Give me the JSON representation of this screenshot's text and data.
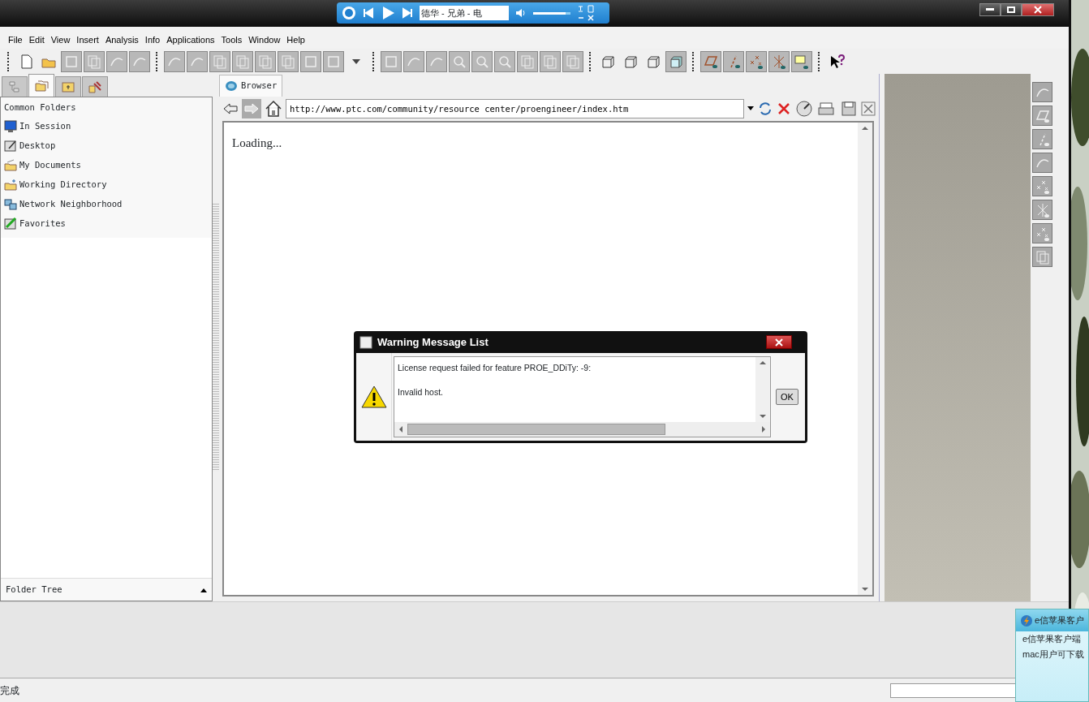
{
  "music_player": {
    "track": "德华 - 兄弟 - 电",
    "level": 0.88
  },
  "menu": [
    "File",
    "Edit",
    "View",
    "Insert",
    "Analysis",
    "Info",
    "Applications",
    "Tools",
    "Window",
    "Help"
  ],
  "left_panel": {
    "tabs": [
      {
        "selected": false
      },
      {
        "selected": true
      },
      {
        "selected": false
      },
      {
        "selected": false
      }
    ],
    "header": "Common Folders",
    "items": [
      {
        "label": "In Session",
        "kind": "monitor"
      },
      {
        "label": "Desktop",
        "kind": "desktop"
      },
      {
        "label": "My Documents",
        "kind": "docs"
      },
      {
        "label": "Working Directory",
        "kind": "workdir"
      },
      {
        "label": "Network Neighborhood",
        "kind": "network"
      },
      {
        "label": "Favorites",
        "kind": "favorites"
      }
    ],
    "footer": "Folder Tree"
  },
  "browser": {
    "tab": "Browser",
    "url": "http://www.ptc.com/community/resource_center/proengineer/index.htm",
    "content": "Loading..."
  },
  "dialog": {
    "title": "Warning Message List",
    "lines": [
      "License request failed for feature PROE_DDiTy: -9:",
      "Invalid host."
    ],
    "button": "OK"
  },
  "status_bar": {
    "text": "完成"
  },
  "notification": {
    "title": "e信苹果客户",
    "lines": [
      "e信苹果客户端",
      "mac用户可下载"
    ]
  }
}
